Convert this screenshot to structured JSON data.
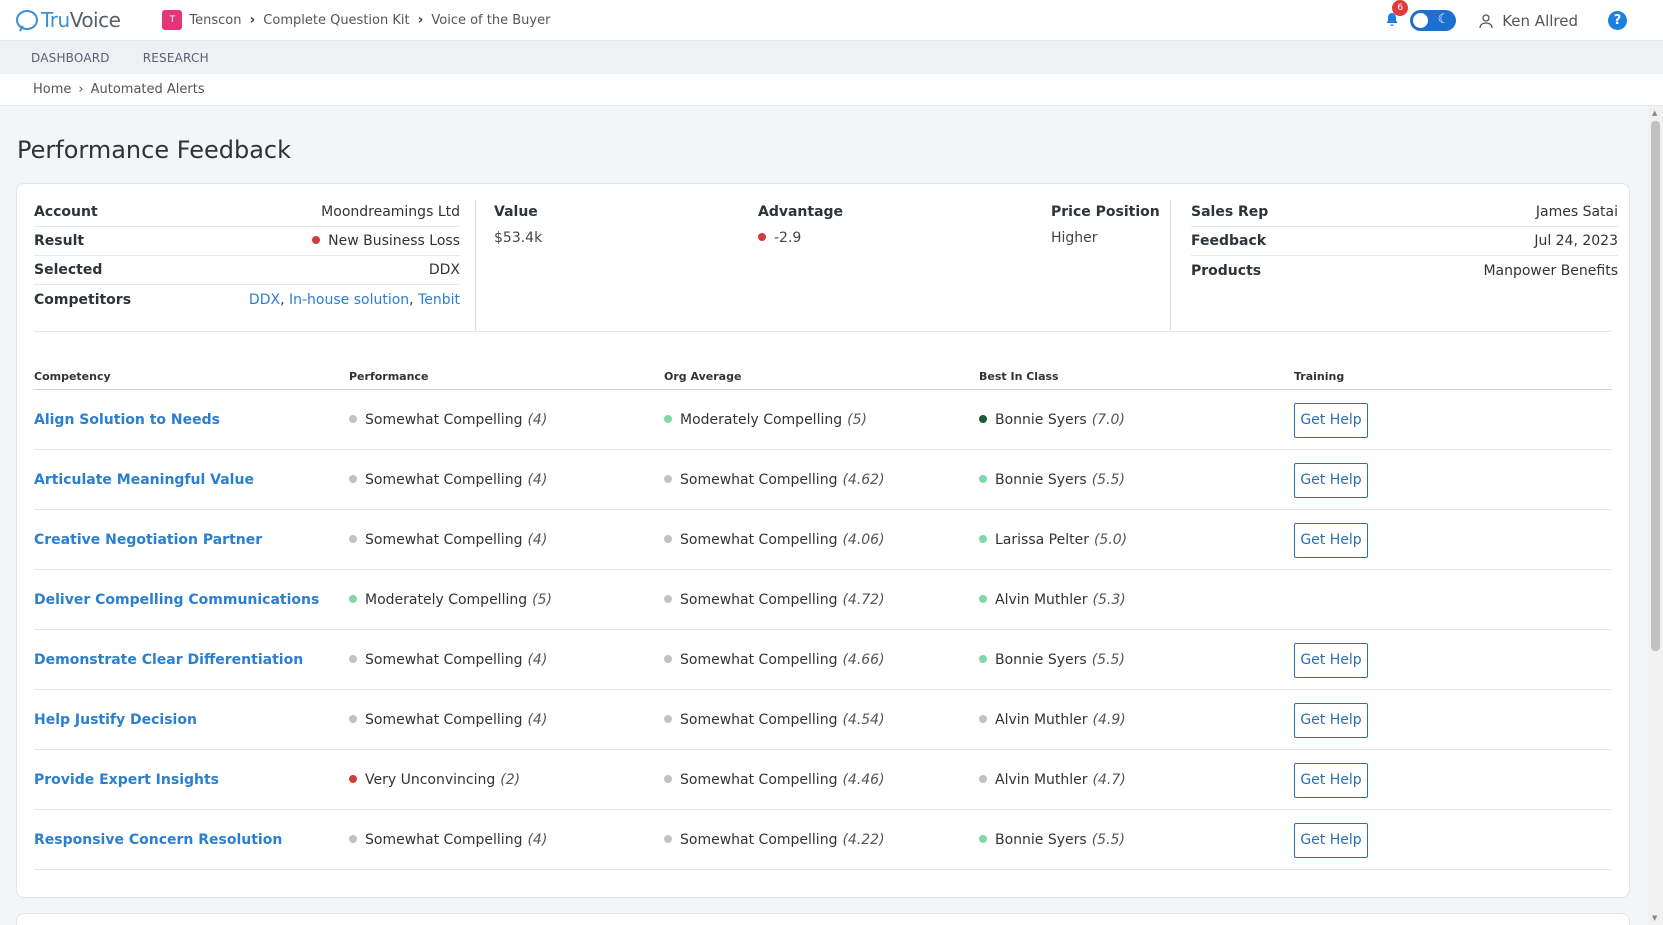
{
  "brand": {
    "name_part1": "Tru",
    "name_part2": "Voice"
  },
  "top_breadcrumb": {
    "badge": "T",
    "items": [
      "Tenscon",
      "Complete Question Kit",
      "Voice of the Buyer"
    ]
  },
  "notifications": {
    "count": "6"
  },
  "user": {
    "name": "Ken Allred"
  },
  "help": {
    "label": "?"
  },
  "nav": [
    "DASHBOARD",
    "RESEARCH"
  ],
  "breadcrumb": {
    "home": "Home",
    "current": "Automated Alerts"
  },
  "page_title": "Performance Feedback",
  "summary": {
    "account_label": "Account",
    "account_value": "Moondreamings Ltd",
    "result_label": "Result",
    "result_value": "New Business Loss",
    "result_color": "#d23c3c",
    "selected_label": "Selected",
    "selected_value": "DDX",
    "competitors_label": "Competitors",
    "competitors": [
      "DDX",
      "In-house solution",
      "Tenbit"
    ],
    "value_label": "Value",
    "value_value": "$53.4k",
    "advantage_label": "Advantage",
    "advantage_value": "-2.9",
    "advantage_color": "#d23c3c",
    "price_label": "Price Position",
    "price_value": "Higher",
    "salesrep_label": "Sales Rep",
    "salesrep_value": "James Satai",
    "feedback_label": "Feedback",
    "feedback_value": "Jul 24, 2023",
    "products_label": "Products",
    "products_value": "Manpower Benefits"
  },
  "table": {
    "headers": [
      "Competency",
      "Performance",
      "Org Average",
      "Best In Class",
      "Training"
    ],
    "button_label": "Get Help",
    "colors": {
      "grey": "#bfc3c8",
      "green": "#7fd8a8",
      "darkgreen": "#1f5a33",
      "red": "#d23c3c"
    },
    "rows": [
      {
        "name": "Align Solution to Needs",
        "perf": "Somewhat Compelling",
        "perf_score": "(4)",
        "perf_color": "#bfc3c8",
        "org": "Moderately Compelling",
        "org_score": "(5)",
        "org_color": "#7fd8a8",
        "best": "Bonnie Syers",
        "best_score": "(7.0)",
        "best_color": "#1f5a33",
        "help": true
      },
      {
        "name": "Articulate Meaningful Value",
        "perf": "Somewhat Compelling",
        "perf_score": "(4)",
        "perf_color": "#bfc3c8",
        "org": "Somewhat Compelling",
        "org_score": "(4.62)",
        "org_color": "#bfc3c8",
        "best": "Bonnie Syers",
        "best_score": "(5.5)",
        "best_color": "#7fd8a8",
        "help": true
      },
      {
        "name": "Creative Negotiation Partner",
        "perf": "Somewhat Compelling",
        "perf_score": "(4)",
        "perf_color": "#bfc3c8",
        "org": "Somewhat Compelling",
        "org_score": "(4.06)",
        "org_color": "#bfc3c8",
        "best": "Larissa Pelter",
        "best_score": "(5.0)",
        "best_color": "#7fd8a8",
        "help": true
      },
      {
        "name": "Deliver Compelling Communications",
        "perf": "Moderately Compelling",
        "perf_score": "(5)",
        "perf_color": "#7fd8a8",
        "org": "Somewhat Compelling",
        "org_score": "(4.72)",
        "org_color": "#bfc3c8",
        "best": "Alvin Muthler",
        "best_score": "(5.3)",
        "best_color": "#7fd8a8",
        "help": false
      },
      {
        "name": "Demonstrate Clear Differentiation",
        "perf": "Somewhat Compelling",
        "perf_score": "(4)",
        "perf_color": "#bfc3c8",
        "org": "Somewhat Compelling",
        "org_score": "(4.66)",
        "org_color": "#bfc3c8",
        "best": "Bonnie Syers",
        "best_score": "(5.5)",
        "best_color": "#7fd8a8",
        "help": true
      },
      {
        "name": "Help Justify Decision",
        "perf": "Somewhat Compelling",
        "perf_score": "(4)",
        "perf_color": "#bfc3c8",
        "org": "Somewhat Compelling",
        "org_score": "(4.54)",
        "org_color": "#bfc3c8",
        "best": "Alvin Muthler",
        "best_score": "(4.9)",
        "best_color": "#bfc3c8",
        "help": true
      },
      {
        "name": "Provide Expert Insights",
        "perf": "Very Unconvincing",
        "perf_score": "(2)",
        "perf_color": "#d23c3c",
        "org": "Somewhat Compelling",
        "org_score": "(4.46)",
        "org_color": "#bfc3c8",
        "best": "Alvin Muthler",
        "best_score": "(4.7)",
        "best_color": "#bfc3c8",
        "help": true
      },
      {
        "name": "Responsive Concern Resolution",
        "perf": "Somewhat Compelling",
        "perf_score": "(4)",
        "perf_color": "#bfc3c8",
        "org": "Somewhat Compelling",
        "org_score": "(4.22)",
        "org_color": "#bfc3c8",
        "best": "Bonnie Syers",
        "best_score": "(5.5)",
        "best_color": "#7fd8a8",
        "help": true
      }
    ]
  }
}
